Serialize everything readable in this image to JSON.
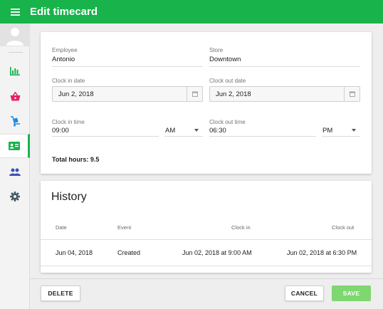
{
  "topbar": {
    "title": "Edit timecard",
    "menu_icon": "menu-icon"
  },
  "sidebar": {
    "avatar_icon": "user-avatar-icon",
    "items": [
      {
        "icon": "bar-chart-icon",
        "color": "#18b34b",
        "active": false
      },
      {
        "icon": "basket-icon",
        "color": "#e91e63",
        "active": false
      },
      {
        "icon": "dolly-icon",
        "color": "#1e88e5",
        "active": false
      },
      {
        "icon": "id-card-icon",
        "color": "#18b34b",
        "active": true
      },
      {
        "icon": "people-icon",
        "color": "#3f51b5",
        "active": false
      },
      {
        "icon": "gear-icon",
        "color": "#455a64",
        "active": false
      }
    ]
  },
  "form": {
    "employee": {
      "label": "Employee",
      "value": "Antonio"
    },
    "store": {
      "label": "Store",
      "value": "Downtown"
    },
    "clock_in_date": {
      "label": "Clock in date",
      "value": "Jun 2, 2018"
    },
    "clock_out_date": {
      "label": "Clock out date",
      "value": "Jun 2, 2018"
    },
    "clock_in_time": {
      "label": "Clock in time",
      "value": "09:00",
      "ampm": "AM"
    },
    "clock_out_time": {
      "label": "Clock out time",
      "value": "06:30",
      "ampm": "PM"
    },
    "total_hours": "Total hours: 9.5"
  },
  "history": {
    "title": "History",
    "columns": [
      "Date",
      "Event",
      "Clock in",
      "Clock out"
    ],
    "rows": [
      {
        "date": "Jun 04, 2018",
        "event": "Created",
        "clock_in": "Jun 02, 2018 at  9:00 AM",
        "clock_out": "Jun 02, 2018 at  6:30 PM"
      }
    ]
  },
  "footer": {
    "delete_label": "DELETE",
    "cancel_label": "CANCEL",
    "save_label": "SAVE"
  },
  "colors": {
    "brand": "#18b34b",
    "save_button": "#7ed76f"
  }
}
